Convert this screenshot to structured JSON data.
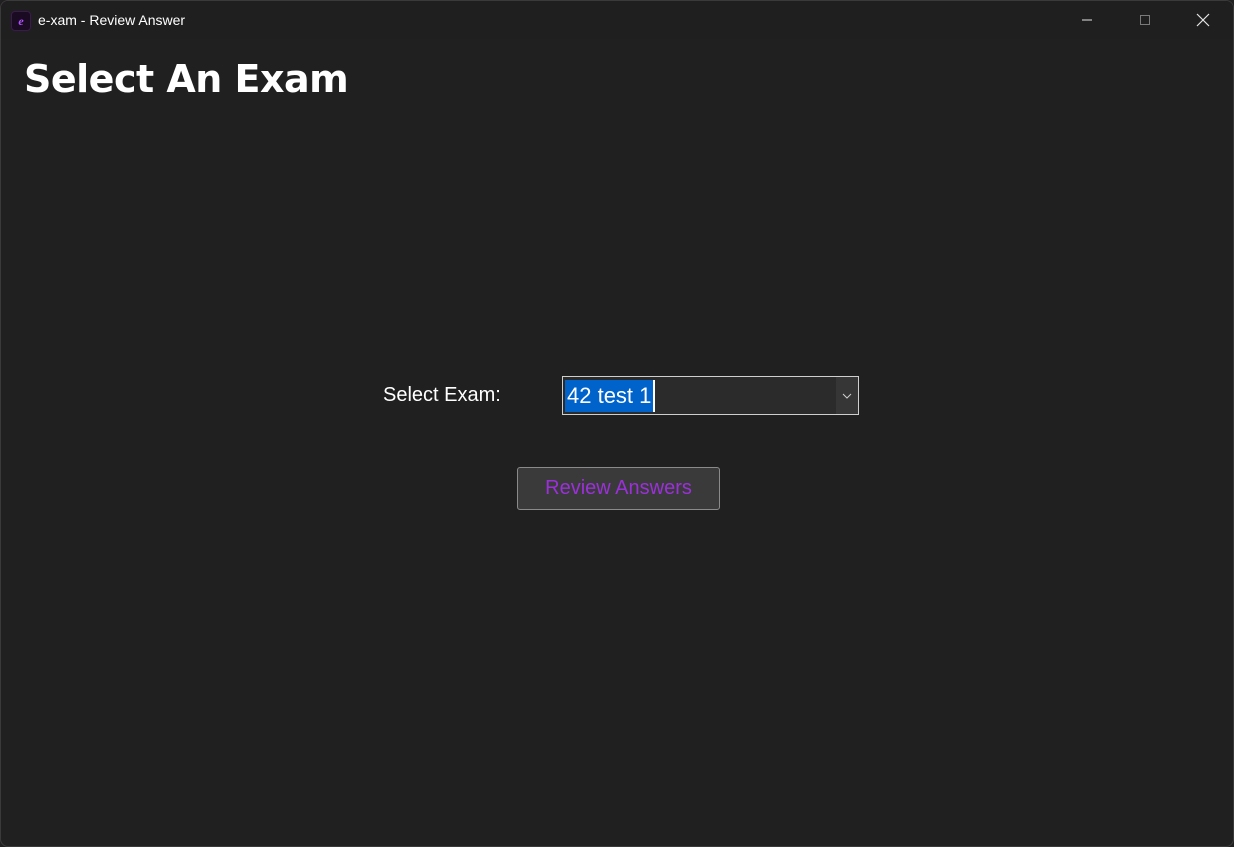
{
  "window": {
    "title": "e-xam - Review Answer",
    "app_icon_letter": "e",
    "icons": {
      "minimize": "minimize-icon",
      "maximize": "maximize-icon",
      "close": "close-icon"
    }
  },
  "main": {
    "page_title": "Select An Exam",
    "exam_label": "Select Exam:",
    "exam_select": {
      "value": "42 test 1",
      "arrow_icon": "chevron-down-icon"
    },
    "review_button_label": "Review Answers"
  },
  "colors": {
    "background": "#202020",
    "selection_highlight": "#0063cc",
    "button_text_accent": "#9b30d9",
    "app_icon_accent": "#b050ff"
  }
}
